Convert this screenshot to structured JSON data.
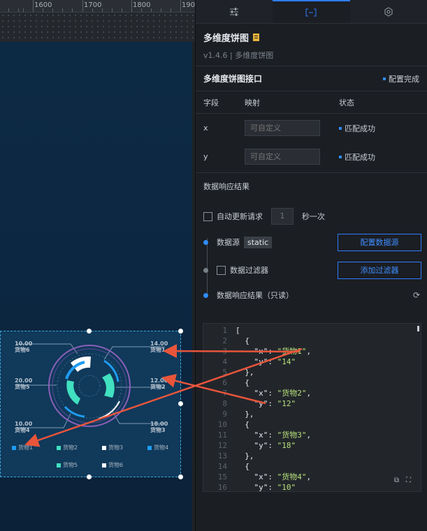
{
  "ruler": {
    "labels": [
      "1600",
      "1700",
      "1800",
      "190"
    ]
  },
  "widget": {
    "labels_left": [
      {
        "value": "10.00",
        "name": "货物6"
      },
      {
        "value": "20.00",
        "name": "货物5"
      },
      {
        "value": "10.00",
        "name": "货物4"
      }
    ],
    "labels_right": [
      {
        "value": "14.00",
        "name": "货物1"
      },
      {
        "value": "12.00",
        "name": "货物2"
      },
      {
        "value": "18.00",
        "name": "货物3"
      }
    ],
    "legend": [
      {
        "name": "货物1",
        "color": "#1e9cf0"
      },
      {
        "name": "货物2",
        "color": "#40e0c0"
      },
      {
        "name": "货物3",
        "color": "#ffffff"
      },
      {
        "name": "货物4",
        "color": "#1e9cf0"
      },
      {
        "name": "货物5",
        "color": "#40e0c0"
      },
      {
        "name": "货物6",
        "color": "#ffffff"
      }
    ]
  },
  "panel": {
    "tabs": [
      {
        "name": "tab-style",
        "icon": "sliders-icon"
      },
      {
        "name": "tab-data",
        "icon": "bracket-icon"
      },
      {
        "name": "tab-interaction",
        "icon": "refresh-hex-icon"
      }
    ],
    "title": "多维度饼图",
    "subtitle": "v1.4.6 | 多维度饼图",
    "interface_title": "多维度饼图接口",
    "interface_status": "配置完成",
    "table_head": {
      "field": "字段",
      "mapping": "映射",
      "status": "状态"
    },
    "fields": [
      {
        "field": "x",
        "placeholder": "可自定义",
        "status": "匹配成功"
      },
      {
        "field": "y",
        "placeholder": "可自定义",
        "status": "匹配成功"
      }
    ],
    "result_title": "数据响应结果",
    "auto_update_label": "自动更新请求",
    "auto_update_value": "1",
    "auto_update_unit": "秒一次",
    "data_source_label": "数据源",
    "data_source_value": "static",
    "config_source_button": "配置数据源",
    "filter_label": "数据过滤器",
    "add_filter_button": "添加过滤器",
    "readonly_result_label": "数据响应结果（只读）"
  },
  "code": {
    "line_numbers": [
      "1",
      "2",
      "3",
      "4",
      "5",
      "6",
      "7",
      "8",
      "9",
      "10",
      "11",
      "12",
      "13",
      "14",
      "15",
      "16"
    ],
    "json_items": [
      {
        "x": "货物1",
        "y": "14"
      },
      {
        "x": "货物2",
        "y": "12"
      },
      {
        "x": "货物3",
        "y": "18"
      },
      {
        "x": "货物4",
        "y": "10"
      }
    ]
  },
  "colors": {
    "accent": "#2f7bff",
    "arrow": "#e8553b",
    "success_dot": "#2f8cff"
  }
}
